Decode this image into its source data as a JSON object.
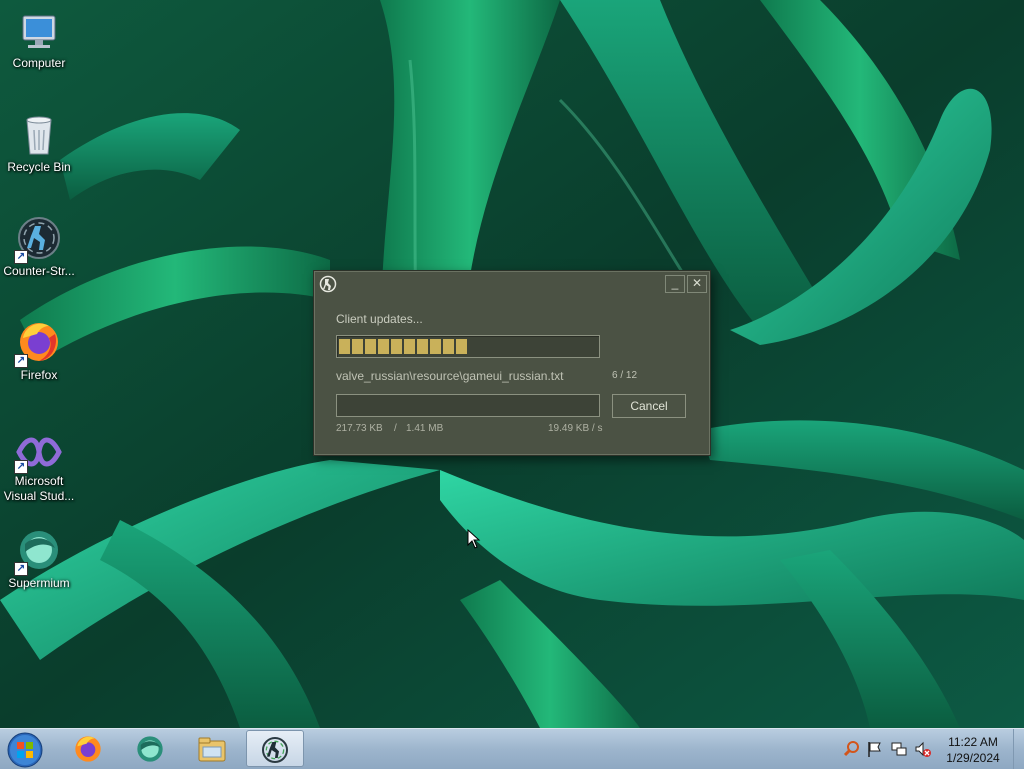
{
  "desktop": {
    "icons": [
      {
        "label": "Computer",
        "icon": "computer-icon"
      },
      {
        "label": "Recycle Bin",
        "icon": "recycle-bin-icon"
      },
      {
        "label": "Counter-Str...",
        "icon": "counter-strike-icon"
      },
      {
        "label": "Firefox",
        "icon": "firefox-icon"
      },
      {
        "label": "Microsoft Visual Stud...",
        "icon": "visual-studio-icon"
      },
      {
        "label": "Supermium",
        "icon": "supermium-icon"
      }
    ]
  },
  "dialog": {
    "status": "Client updates...",
    "overall_progress": {
      "completed": 6,
      "total": 12
    },
    "current_file": "valve_russian\\resource\\gameui_russian.txt",
    "file_count": "6 / 12",
    "file_progress_fraction": 0.0,
    "downloaded": "217.73 KB",
    "separator": "/",
    "total_size": "1.41 MB",
    "speed": "19.49 KB / s",
    "cancel_label": "Cancel",
    "minimize_glyph": "_",
    "close_glyph": "✕"
  },
  "taskbar": {
    "pinned": [
      {
        "icon": "firefox-icon"
      },
      {
        "icon": "supermium-icon"
      },
      {
        "icon": "file-explorer-icon"
      },
      {
        "icon": "counter-strike-icon",
        "active": true
      }
    ],
    "tray": [
      "search-icon",
      "flag-icon",
      "network-icon",
      "volume-muted-icon"
    ],
    "time": "11:22 AM",
    "date": "1/29/2024"
  },
  "colors": {
    "dialog_bg": "#4b5244",
    "progress_fill": "#c9b15a",
    "taskbar": "#9db5cd"
  }
}
